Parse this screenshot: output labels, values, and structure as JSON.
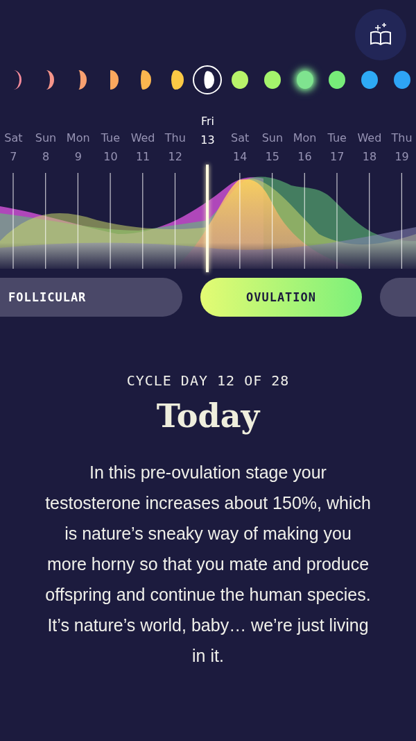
{
  "moons": [
    {
      "color": "#f28a9a",
      "selected": false,
      "glow": false
    },
    {
      "color": "#f6958a",
      "selected": false,
      "glow": false
    },
    {
      "color": "#f8a070",
      "selected": false,
      "glow": false
    },
    {
      "color": "#fba85e",
      "selected": false,
      "glow": false
    },
    {
      "color": "#fbb64f",
      "selected": false,
      "glow": false
    },
    {
      "color": "#fcc945",
      "selected": false,
      "glow": false
    },
    {
      "color": "#ffffff",
      "selected": true,
      "glow": false
    },
    {
      "color": "#b8f36a",
      "selected": false,
      "glow": false
    },
    {
      "color": "#a4f46c",
      "selected": false,
      "glow": false
    },
    {
      "color": "#7fe38f",
      "selected": false,
      "glow": true
    },
    {
      "color": "#77ec79",
      "selected": false,
      "glow": false
    },
    {
      "color": "#2eaaf5",
      "selected": false,
      "glow": false
    },
    {
      "color": "#2ea4f6",
      "selected": false,
      "glow": false
    }
  ],
  "days": [
    {
      "day": "Sat",
      "date": "7",
      "selected": false
    },
    {
      "day": "Sun",
      "date": "8",
      "selected": false
    },
    {
      "day": "Mon",
      "date": "9",
      "selected": false
    },
    {
      "day": "Tue",
      "date": "10",
      "selected": false
    },
    {
      "day": "Wed",
      "date": "11",
      "selected": false
    },
    {
      "day": "Thu",
      "date": "12",
      "selected": false
    },
    {
      "day": "Fri",
      "date": "13",
      "selected": true
    },
    {
      "day": "Sat",
      "date": "14",
      "selected": false
    },
    {
      "day": "Sun",
      "date": "15",
      "selected": false
    },
    {
      "day": "Mon",
      "date": "16",
      "selected": false
    },
    {
      "day": "Tue",
      "date": "17",
      "selected": false
    },
    {
      "day": "Wed",
      "date": "18",
      "selected": false
    },
    {
      "day": "Thu",
      "date": "19",
      "selected": false
    }
  ],
  "phases": [
    {
      "label": "FOLLICULAR",
      "selected": false
    },
    {
      "label": "OVULATION",
      "selected": true
    },
    {
      "selected": false
    }
  ],
  "cycle_day": "CYCLE DAY 12 OF 28",
  "title": "Today",
  "description": "In this pre-ovulation stage your testosterone increases about 150%, which is nature’s sneaky way of making you more horny so that you mate and produce offspring and continue the human species. It’s nature’s world, baby… we’re just living in it."
}
